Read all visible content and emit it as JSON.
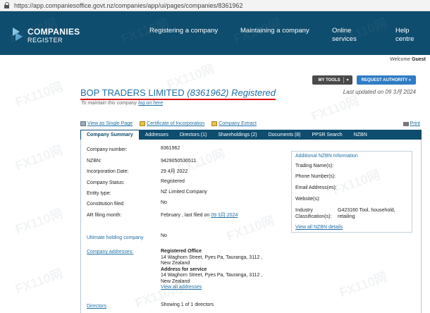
{
  "browser": {
    "url": "https://app.companiesoffice.govt.nz/companies/app/ui/pages/companies/8361962"
  },
  "header": {
    "logo_line1": "COMPANIES",
    "logo_line2": "REGISTER",
    "nav": [
      {
        "line1": "Registering a company",
        "line2": ""
      },
      {
        "line1": "Maintaining a company",
        "line2": ""
      },
      {
        "line1": "Online",
        "line2": "services"
      },
      {
        "line1": "Help",
        "line2": "centre"
      }
    ]
  },
  "welcome": {
    "prefix": "Welcome",
    "user": "Guest"
  },
  "toolbar": {
    "my_tools": "MY TOOLS",
    "request_authority": "REQUEST AUTHORITY »"
  },
  "company": {
    "name": "BOP TRADERS LIMITED",
    "number_paren": "(8361962)",
    "status_word": "Registered",
    "last_updated": "Last updated on 09 3月 2024",
    "maintain_prefix": "To maintain this company",
    "maintain_link": "log on here"
  },
  "links": {
    "single_page": "View as Single Page",
    "certificate": "Certificate of Incorporation",
    "extract": "Company Extract",
    "print": "Print"
  },
  "tabs": [
    "Company Summary",
    "Addresses",
    "Directors (1)",
    "Shareholdings (2)",
    "Documents (8)",
    "PPSR Search",
    "NZBN"
  ],
  "summary": {
    "company_number_label": "Company number:",
    "company_number": "8361962",
    "nzbn_label": "NZBN:",
    "nzbn": "9429050536511",
    "incorporation_label": "Incorporation Date:",
    "incorporation": "29 4月 2022",
    "status_label": "Company Status:",
    "status": "Registered",
    "entity_label": "Entity type:",
    "entity": "NZ Limited Company",
    "constitution_label": "Constitution filed:",
    "constitution": "No",
    "ar_label": "AR filing month:",
    "ar_value_prefix": "February , last filed on",
    "ar_value_link": "09 3月 2024",
    "holding_label": "Ultimate holding company",
    "holding": "No",
    "addresses_label": "Company addresses:",
    "registered_office_title": "Registered Office",
    "registered_office_line1": "14 Waghorn Street, Pyes Pa, Tauranga, 3112 ,",
    "registered_office_line2": "New Zealand",
    "service_title": "Address for service",
    "service_line1": "14 Waghorn Street, Pyes Pa, Tauranga, 3112 ,",
    "service_line2": "New Zealand",
    "view_all_addresses": "View all addresses",
    "directors_label": "Directors",
    "directors_value": "Showing 1 of 1 directors"
  },
  "nzbn_info": {
    "heading": "Additional NZBN Information",
    "trading_name": "Trading Name(s):",
    "phone": "Phone Number(s):",
    "email": "Email Address(es):",
    "website": "Website(s):",
    "industry_label_1": "Industry",
    "industry_label_2": "Classification(s):",
    "industry_value_1": "G423160 Tool, household,",
    "industry_value_2": "retailing",
    "view_all": "View all NZBN details"
  },
  "watermark": {
    "text": "FX110网"
  }
}
